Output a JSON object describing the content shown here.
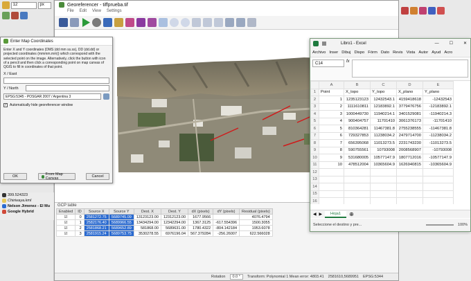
{
  "qgis": {
    "size_value": "12",
    "size_unit": "px",
    "layers": [
      "399.524323",
      "Chiriwaya.kml",
      "Nelson Jimenez - El Mu",
      "Google Hybrid"
    ]
  },
  "georef": {
    "title": "Georeferencer - tiffprueba.tif",
    "menu": [
      "File",
      "Edit",
      "View",
      "Settings"
    ],
    "gcp_title": "GCP table",
    "gcp_headers": [
      "Enabled",
      "ID",
      "Source X",
      "Source Y",
      "Dest. X",
      "Dest. Y",
      "dX (pixels)",
      "dY (pixels)",
      "Residual (pixels)"
    ],
    "gcp_rows": [
      [
        "0",
        "2581272.75",
        "5689745.09",
        "13123123.00",
        "12312123.00",
        "1677.9566",
        "4076.4794"
      ],
      [
        "1",
        "2582176.40",
        "5689966.55",
        "13434294.00",
        "12342294.00",
        "1367.3125",
        "-617.554396",
        "1500.3055"
      ],
      [
        "2",
        "2581868.21",
        "5689652.89",
        "581868.00",
        "5689631.00",
        "1780.4322",
        "-804.142184",
        "1953.6078"
      ],
      [
        "3",
        "2581915.24",
        "5689753.75",
        "3530278.55",
        "6976196.04",
        "567.379284",
        "-256.26007",
        "622.566028"
      ]
    ],
    "status_rotation_label": "Rotation",
    "status_rotation": "0.0 °",
    "status_transform": "Transform: Polynomial 1 Mean error: 4803.41",
    "status_coords": "2581610,5689951",
    "status_epsg": "EPSG:5344"
  },
  "coord_dialog": {
    "title": "Enter Map Coordinates",
    "description": "Enter X and Y coordinates (DMS (dd mm ss.ss), DD (dd.dd) or projected coordinates (mmmm.mm)) which correspond with the selected point on the image. Alternatively, click the button with icon of a pencil and then click a corresponding point on map canvas of QGIS to fill in coordinates of that point.",
    "x_label": "X / East",
    "y_label": "Y / North",
    "crs": "EPSG:5345 - POSGAR 2007 / Argentina 3",
    "auto_hide": "Automatically hide georeferencer window",
    "ok": "OK",
    "from_canvas": "From Map Canvas",
    "cancel": "Cancel"
  },
  "excel": {
    "title": "Libro1 - Excel",
    "ribbon": [
      "Archivo",
      "Inser",
      "Dibuj",
      "Dispo",
      "Fórm",
      "Dato",
      "Revis",
      "Vista",
      "Autor",
      "Ayud",
      "Acro"
    ],
    "namebox": "C14",
    "columns": [
      "A",
      "B",
      "C",
      "D",
      "E"
    ],
    "header_row": [
      "Point",
      "X_topo",
      "Y_topo",
      "X_plano",
      "Y_plano"
    ],
    "rows": [
      [
        "1",
        "1235123123",
        "12432543.1",
        "4159418618",
        "-12432543"
      ],
      [
        "2",
        "1111610811",
        "12183892.1",
        "3779476756",
        "-12183892.1"
      ],
      [
        "3",
        "1000449730",
        "11940214.1",
        "3401529081",
        "-11940214.3"
      ],
      [
        "4",
        "900404757",
        "11701410",
        "3061376173",
        "-11701410"
      ],
      [
        "5",
        "810364281",
        "11467381.8",
        "2755238555",
        "-11467381.8"
      ],
      [
        "6",
        "729327853",
        "11238034.2",
        "2479714700",
        "-11238034.2"
      ],
      [
        "7",
        "656395068",
        "11013273.5",
        "2231743230",
        "-11013273.5"
      ],
      [
        "8",
        "590755561",
        "10793008",
        "2008568907",
        "-10793008"
      ],
      [
        "9",
        "531680005",
        "10577147.9",
        "1807712016",
        "-10577147.9"
      ],
      [
        "10",
        "478512004",
        "10365604.9",
        "1626940815",
        "-10365604.9"
      ]
    ],
    "sheet_tab": "Hoja1",
    "status": "Seleccione el destino y pre...",
    "zoom": "100%"
  },
  "colors": {
    "excel_green": "#1e7a3e",
    "selection_blue": "#2a6ad0"
  }
}
